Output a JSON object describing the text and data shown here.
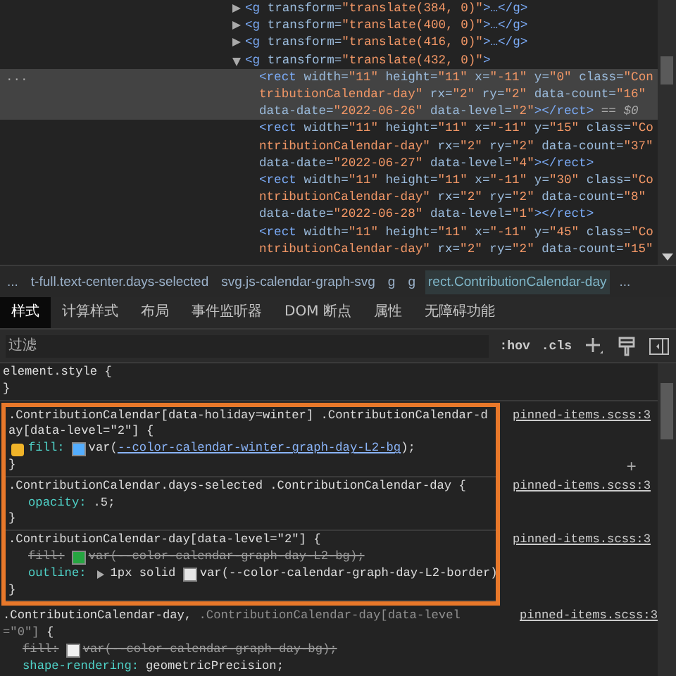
{
  "dom_tree": {
    "nodes": [
      {
        "markup": "<g transform=\"translate(384, 0)\">…</g>",
        "expanded": false,
        "selected": false
      },
      {
        "markup": "<g transform=\"translate(400, 0)\">…</g>",
        "expanded": false,
        "selected": false
      },
      {
        "markup": "<g transform=\"translate(416, 0)\">…</g>",
        "expanded": false,
        "selected": false
      },
      {
        "markup": "<g transform=\"translate(432, 0)\">",
        "expanded": true,
        "selected": false,
        "children": [
          {
            "markup": "<rect width=\"11\" height=\"11\" x=\"-11\" y=\"0\" class=\"ContributionCalendar-day\" rx=\"2\" ry=\"2\" data-count=\"16\" data-date=\"2022-06-26\" data-level=\"2\"></rect>",
            "selected": true,
            "marker": "...",
            "console_ref": "== $0"
          },
          {
            "markup": "<rect width=\"11\" height=\"11\" x=\"-11\" y=\"15\" class=\"ContributionCalendar-day\" rx=\"2\" ry=\"2\" data-count=\"37\" data-date=\"2022-06-27\" data-level=\"4\"></rect>",
            "selected": false
          },
          {
            "markup": "<rect width=\"11\" height=\"11\" x=\"-11\" y=\"30\" class=\"ContributionCalendar-day\" rx=\"2\" ry=\"2\" data-count=\"8\" data-date=\"2022-06-28\" data-level=\"1\"></rect>",
            "selected": false
          },
          {
            "markup": "<rect width=\"11\" height=\"11\" x=\"-11\" y=\"45\" class=\"ContributionCalendar-day\" rx=\"2\" ry=\"2\" data-count=\"15\"",
            "selected": false
          }
        ]
      }
    ]
  },
  "breadcrumbs": [
    {
      "label": "...",
      "selected": false
    },
    {
      "label": "t-full.text-center.days-selected",
      "selected": false
    },
    {
      "label": "svg.js-calendar-graph-svg",
      "selected": false
    },
    {
      "label": "g",
      "selected": false
    },
    {
      "label": "g",
      "selected": false
    },
    {
      "label": "rect.ContributionCalendar-day",
      "selected": true
    },
    {
      "label": "...",
      "selected": false
    }
  ],
  "tabs": [
    {
      "label": "样式",
      "selected": true
    },
    {
      "label": "计算样式",
      "selected": false
    },
    {
      "label": "布局",
      "selected": false
    },
    {
      "label": "事件监听器",
      "selected": false
    },
    {
      "label": "DOM 断点",
      "selected": false
    },
    {
      "label": "属性",
      "selected": false
    },
    {
      "label": "无障碍功能",
      "selected": false
    }
  ],
  "filter": {
    "placeholder": "过滤",
    "toggles": [
      ":hov",
      ".cls"
    ]
  },
  "rules": [
    {
      "selector": [
        {
          "text": "element.style {",
          "matched": true
        }
      ],
      "close": "}",
      "highlighted": false
    },
    {
      "selector": [
        {
          "text": ".ContributionCalendar[data-holiday=winter] .ContributionCalendar-day[data-level=\"2\"] {",
          "matched": true
        }
      ],
      "source": "pinned-items.scss:3",
      "close": "}",
      "highlighted": true,
      "add_button": "+",
      "declarations": [
        {
          "property": "fill:",
          "overridden": false,
          "checkbox": {
            "checked": true
          },
          "value": [
            {
              "kind": "swatch",
              "color": "#54aeff"
            },
            {
              "kind": "text",
              "text": "var("
            },
            {
              "kind": "link",
              "text": "--color-calendar-winter-graph-day-L2-bg"
            },
            {
              "kind": "text",
              "text": ");"
            }
          ]
        }
      ]
    },
    {
      "selector": [
        {
          "text": ".ContributionCalendar.days-selected .ContributionCalendar-day {",
          "matched": true
        }
      ],
      "source": "pinned-items.scss:3",
      "close": "}",
      "highlighted": true,
      "declarations": [
        {
          "property": "opacity:",
          "overridden": false,
          "value": [
            {
              "kind": "text",
              "text": ".5;"
            }
          ]
        }
      ]
    },
    {
      "selector": [
        {
          "text": ".ContributionCalendar-day[data-level=\"2\"] {",
          "matched": true
        }
      ],
      "source": "pinned-items.scss:3",
      "close": "}",
      "highlighted": true,
      "declarations": [
        {
          "property": "fill:",
          "overridden": true,
          "value": [
            {
              "kind": "swatch",
              "color": "#26a641"
            },
            {
              "kind": "text",
              "text": "var(--color-calendar-graph-day-L2-bg);"
            }
          ]
        },
        {
          "property": "outline:",
          "overridden": false,
          "expandable": true,
          "value": [
            {
              "kind": "text",
              "text": "1px solid "
            },
            {
              "kind": "swatch",
              "color": "#e6e6e6"
            },
            {
              "kind": "text",
              "text": "var(--color-calendar-graph-day-L2-border)"
            }
          ]
        }
      ]
    },
    {
      "selector": [
        {
          "text": ".ContributionCalendar-day,",
          "matched": true
        },
        {
          "text": " .ContributionCalendar-day[data-level=\"0\"]",
          "matched": false
        },
        {
          "text": " {",
          "matched": true
        }
      ],
      "source": "pinned-items.scss:3",
      "highlighted": false,
      "declarations": [
        {
          "property": "fill:",
          "overridden": true,
          "value": [
            {
              "kind": "swatch",
              "color": "#f0f0f0"
            },
            {
              "kind": "text",
              "text": "var(--color-calendar-graph-day-bg);"
            }
          ]
        },
        {
          "property": "shape-rendering:",
          "overridden": false,
          "value": [
            {
              "kind": "text",
              "text": "geometricPrecision;"
            }
          ]
        }
      ]
    }
  ]
}
